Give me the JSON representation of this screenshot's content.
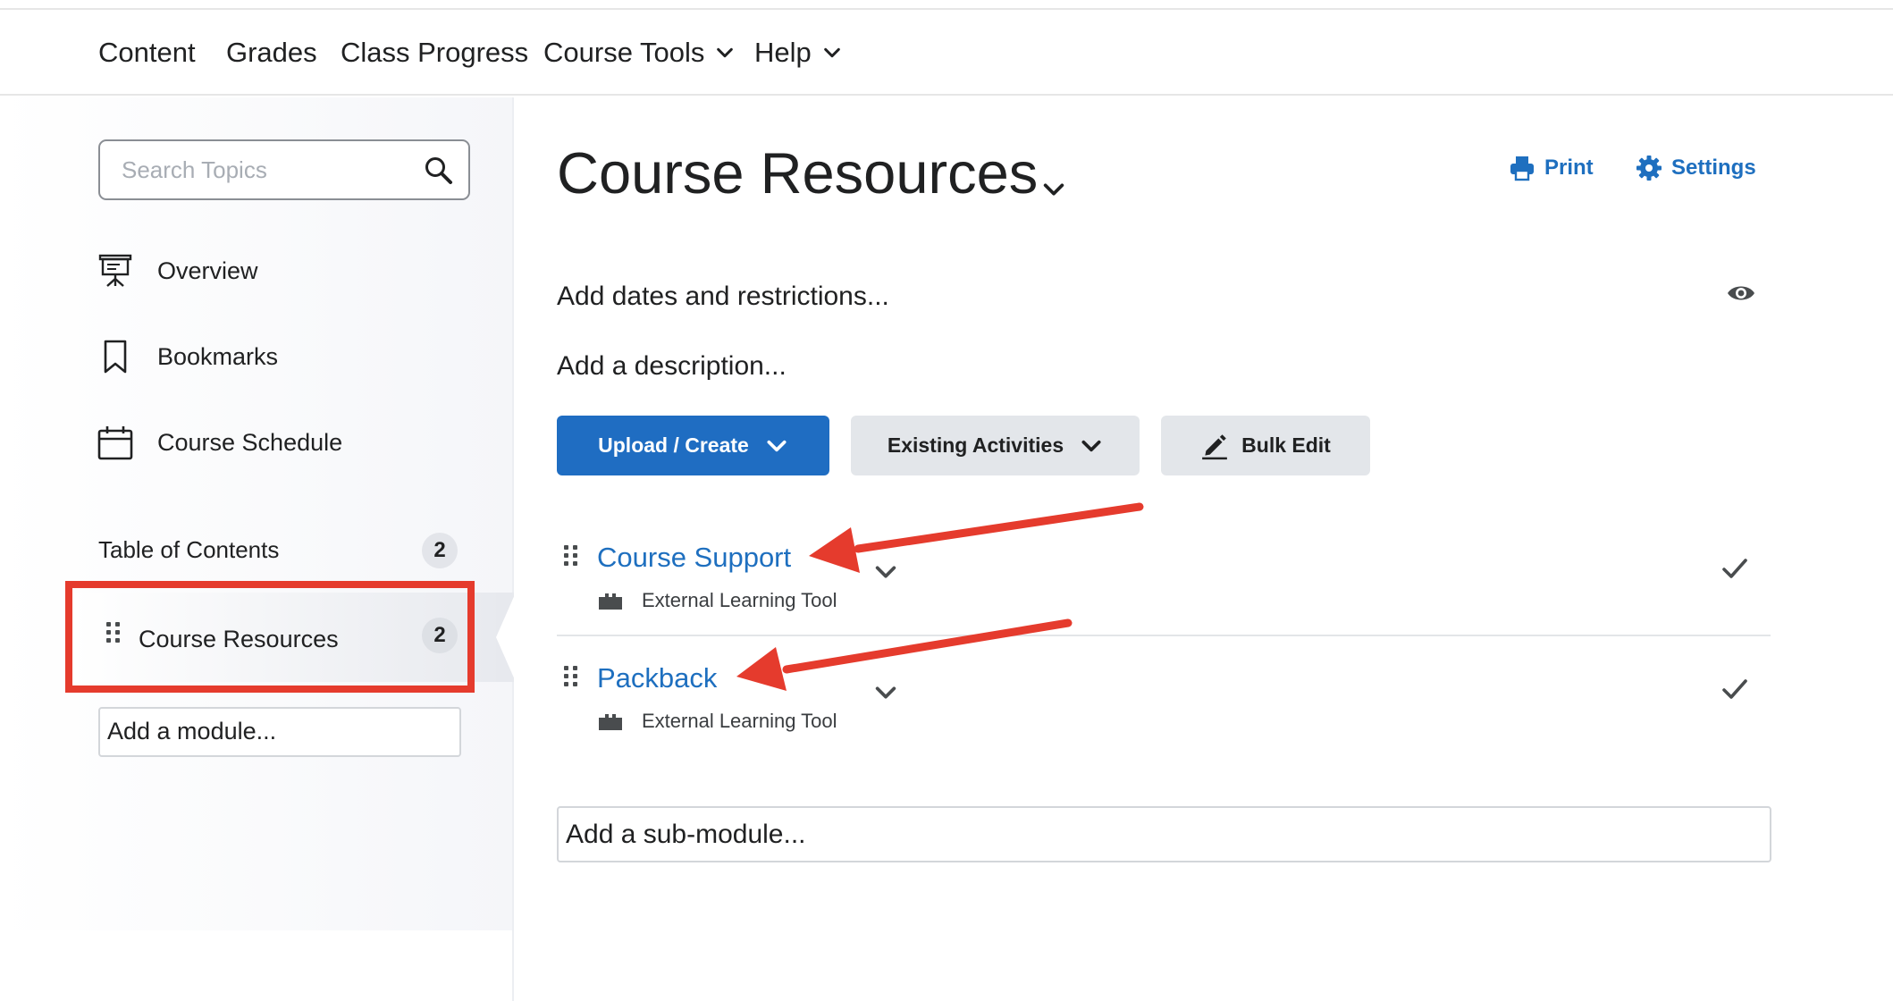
{
  "nav": {
    "items": [
      {
        "label": "Content"
      },
      {
        "label": "Grades"
      },
      {
        "label": "Class Progress"
      },
      {
        "label": "Course Tools"
      },
      {
        "label": "Help"
      }
    ]
  },
  "sidebar": {
    "search_placeholder": "Search Topics",
    "links": [
      {
        "label": "Overview",
        "icon": "presentation-icon"
      },
      {
        "label": "Bookmarks",
        "icon": "bookmark-icon"
      },
      {
        "label": "Course Schedule",
        "icon": "calendar-icon"
      }
    ],
    "toc_label": "Table of Contents",
    "toc_count": "2",
    "module": {
      "label": "Course Resources",
      "count": "2"
    },
    "add_module": "Add a module..."
  },
  "main": {
    "title": "Course Resources",
    "print_label": "Print",
    "settings_label": "Settings",
    "add_dates": "Add dates and restrictions...",
    "add_description": "Add a description...",
    "buttons": {
      "upload": "Upload / Create",
      "existing": "Existing Activities",
      "bulk": "Bulk Edit"
    },
    "items": [
      {
        "title": "Course Support",
        "type": "External Learning Tool"
      },
      {
        "title": "Packback",
        "type": "External Learning Tool"
      }
    ],
    "add_submodule": "Add a sub-module..."
  },
  "colors": {
    "accent": "#1f6dc2",
    "link": "#1e6fbf",
    "annotation": "#e53b2d"
  }
}
